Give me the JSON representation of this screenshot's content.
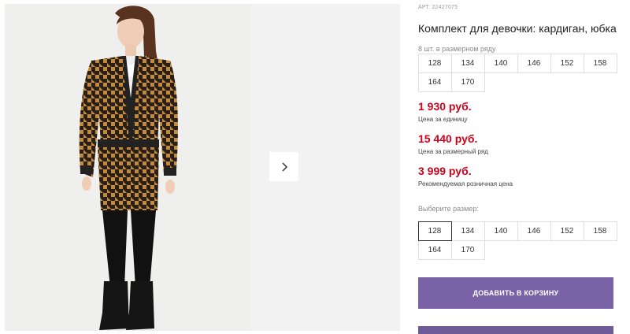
{
  "product": {
    "article": "АРТ. 22427075",
    "title": "Комплект для девочки: кардиган, юбка"
  },
  "size_row": {
    "hint": "8 шт. в размерном ряду",
    "sizes": [
      "128",
      "134",
      "140",
      "146",
      "152",
      "158",
      "164",
      "170"
    ]
  },
  "prices": [
    {
      "value": "1 930 руб.",
      "note": "Цена за единицу"
    },
    {
      "value": "15 440 руб.",
      "note": "Цена за размерный ряд"
    },
    {
      "value": "3 999 руб.",
      "note": "Рекомендуемая розничная цена"
    }
  ],
  "size_select": {
    "hint": "Выберите размер:",
    "sizes": [
      "128",
      "134",
      "140",
      "146",
      "152",
      "158",
      "164",
      "170"
    ],
    "selected": "128"
  },
  "cart_button": {
    "label": "ДОБАВИТЬ В КОРЗИНУ"
  },
  "icons": {
    "next": "chevron-right-icon"
  },
  "colors": {
    "price": "#d0021b",
    "button": "#7a62a6",
    "button_2": "#6e5a97"
  }
}
